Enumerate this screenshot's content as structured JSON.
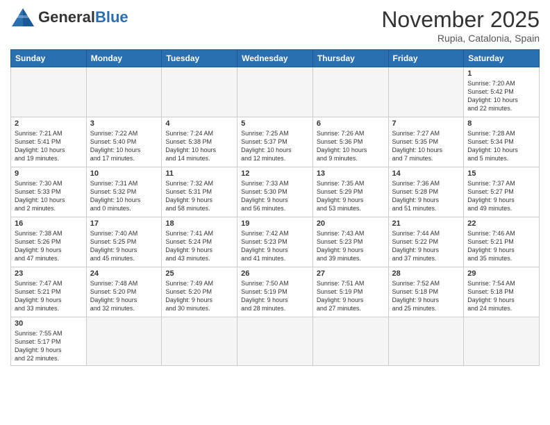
{
  "header": {
    "logo_general": "General",
    "logo_blue": "Blue",
    "month_title": "November 2025",
    "location": "Rupia, Catalonia, Spain"
  },
  "days_of_week": [
    "Sunday",
    "Monday",
    "Tuesday",
    "Wednesday",
    "Thursday",
    "Friday",
    "Saturday"
  ],
  "weeks": [
    [
      {
        "day": "",
        "info": ""
      },
      {
        "day": "",
        "info": ""
      },
      {
        "day": "",
        "info": ""
      },
      {
        "day": "",
        "info": ""
      },
      {
        "day": "",
        "info": ""
      },
      {
        "day": "",
        "info": ""
      },
      {
        "day": "1",
        "info": "Sunrise: 7:20 AM\nSunset: 5:42 PM\nDaylight: 10 hours\nand 22 minutes."
      }
    ],
    [
      {
        "day": "2",
        "info": "Sunrise: 7:21 AM\nSunset: 5:41 PM\nDaylight: 10 hours\nand 19 minutes."
      },
      {
        "day": "3",
        "info": "Sunrise: 7:22 AM\nSunset: 5:40 PM\nDaylight: 10 hours\nand 17 minutes."
      },
      {
        "day": "4",
        "info": "Sunrise: 7:24 AM\nSunset: 5:38 PM\nDaylight: 10 hours\nand 14 minutes."
      },
      {
        "day": "5",
        "info": "Sunrise: 7:25 AM\nSunset: 5:37 PM\nDaylight: 10 hours\nand 12 minutes."
      },
      {
        "day": "6",
        "info": "Sunrise: 7:26 AM\nSunset: 5:36 PM\nDaylight: 10 hours\nand 9 minutes."
      },
      {
        "day": "7",
        "info": "Sunrise: 7:27 AM\nSunset: 5:35 PM\nDaylight: 10 hours\nand 7 minutes."
      },
      {
        "day": "8",
        "info": "Sunrise: 7:28 AM\nSunset: 5:34 PM\nDaylight: 10 hours\nand 5 minutes."
      }
    ],
    [
      {
        "day": "9",
        "info": "Sunrise: 7:30 AM\nSunset: 5:33 PM\nDaylight: 10 hours\nand 2 minutes."
      },
      {
        "day": "10",
        "info": "Sunrise: 7:31 AM\nSunset: 5:32 PM\nDaylight: 10 hours\nand 0 minutes."
      },
      {
        "day": "11",
        "info": "Sunrise: 7:32 AM\nSunset: 5:31 PM\nDaylight: 9 hours\nand 58 minutes."
      },
      {
        "day": "12",
        "info": "Sunrise: 7:33 AM\nSunset: 5:30 PM\nDaylight: 9 hours\nand 56 minutes."
      },
      {
        "day": "13",
        "info": "Sunrise: 7:35 AM\nSunset: 5:29 PM\nDaylight: 9 hours\nand 53 minutes."
      },
      {
        "day": "14",
        "info": "Sunrise: 7:36 AM\nSunset: 5:28 PM\nDaylight: 9 hours\nand 51 minutes."
      },
      {
        "day": "15",
        "info": "Sunrise: 7:37 AM\nSunset: 5:27 PM\nDaylight: 9 hours\nand 49 minutes."
      }
    ],
    [
      {
        "day": "16",
        "info": "Sunrise: 7:38 AM\nSunset: 5:26 PM\nDaylight: 9 hours\nand 47 minutes."
      },
      {
        "day": "17",
        "info": "Sunrise: 7:40 AM\nSunset: 5:25 PM\nDaylight: 9 hours\nand 45 minutes."
      },
      {
        "day": "18",
        "info": "Sunrise: 7:41 AM\nSunset: 5:24 PM\nDaylight: 9 hours\nand 43 minutes."
      },
      {
        "day": "19",
        "info": "Sunrise: 7:42 AM\nSunset: 5:23 PM\nDaylight: 9 hours\nand 41 minutes."
      },
      {
        "day": "20",
        "info": "Sunrise: 7:43 AM\nSunset: 5:23 PM\nDaylight: 9 hours\nand 39 minutes."
      },
      {
        "day": "21",
        "info": "Sunrise: 7:44 AM\nSunset: 5:22 PM\nDaylight: 9 hours\nand 37 minutes."
      },
      {
        "day": "22",
        "info": "Sunrise: 7:46 AM\nSunset: 5:21 PM\nDaylight: 9 hours\nand 35 minutes."
      }
    ],
    [
      {
        "day": "23",
        "info": "Sunrise: 7:47 AM\nSunset: 5:21 PM\nDaylight: 9 hours\nand 33 minutes."
      },
      {
        "day": "24",
        "info": "Sunrise: 7:48 AM\nSunset: 5:20 PM\nDaylight: 9 hours\nand 32 minutes."
      },
      {
        "day": "25",
        "info": "Sunrise: 7:49 AM\nSunset: 5:20 PM\nDaylight: 9 hours\nand 30 minutes."
      },
      {
        "day": "26",
        "info": "Sunrise: 7:50 AM\nSunset: 5:19 PM\nDaylight: 9 hours\nand 28 minutes."
      },
      {
        "day": "27",
        "info": "Sunrise: 7:51 AM\nSunset: 5:19 PM\nDaylight: 9 hours\nand 27 minutes."
      },
      {
        "day": "28",
        "info": "Sunrise: 7:52 AM\nSunset: 5:18 PM\nDaylight: 9 hours\nand 25 minutes."
      },
      {
        "day": "29",
        "info": "Sunrise: 7:54 AM\nSunset: 5:18 PM\nDaylight: 9 hours\nand 24 minutes."
      }
    ],
    [
      {
        "day": "30",
        "info": "Sunrise: 7:55 AM\nSunset: 5:17 PM\nDaylight: 9 hours\nand 22 minutes."
      },
      {
        "day": "",
        "info": ""
      },
      {
        "day": "",
        "info": ""
      },
      {
        "day": "",
        "info": ""
      },
      {
        "day": "",
        "info": ""
      },
      {
        "day": "",
        "info": ""
      },
      {
        "day": "",
        "info": ""
      }
    ]
  ]
}
